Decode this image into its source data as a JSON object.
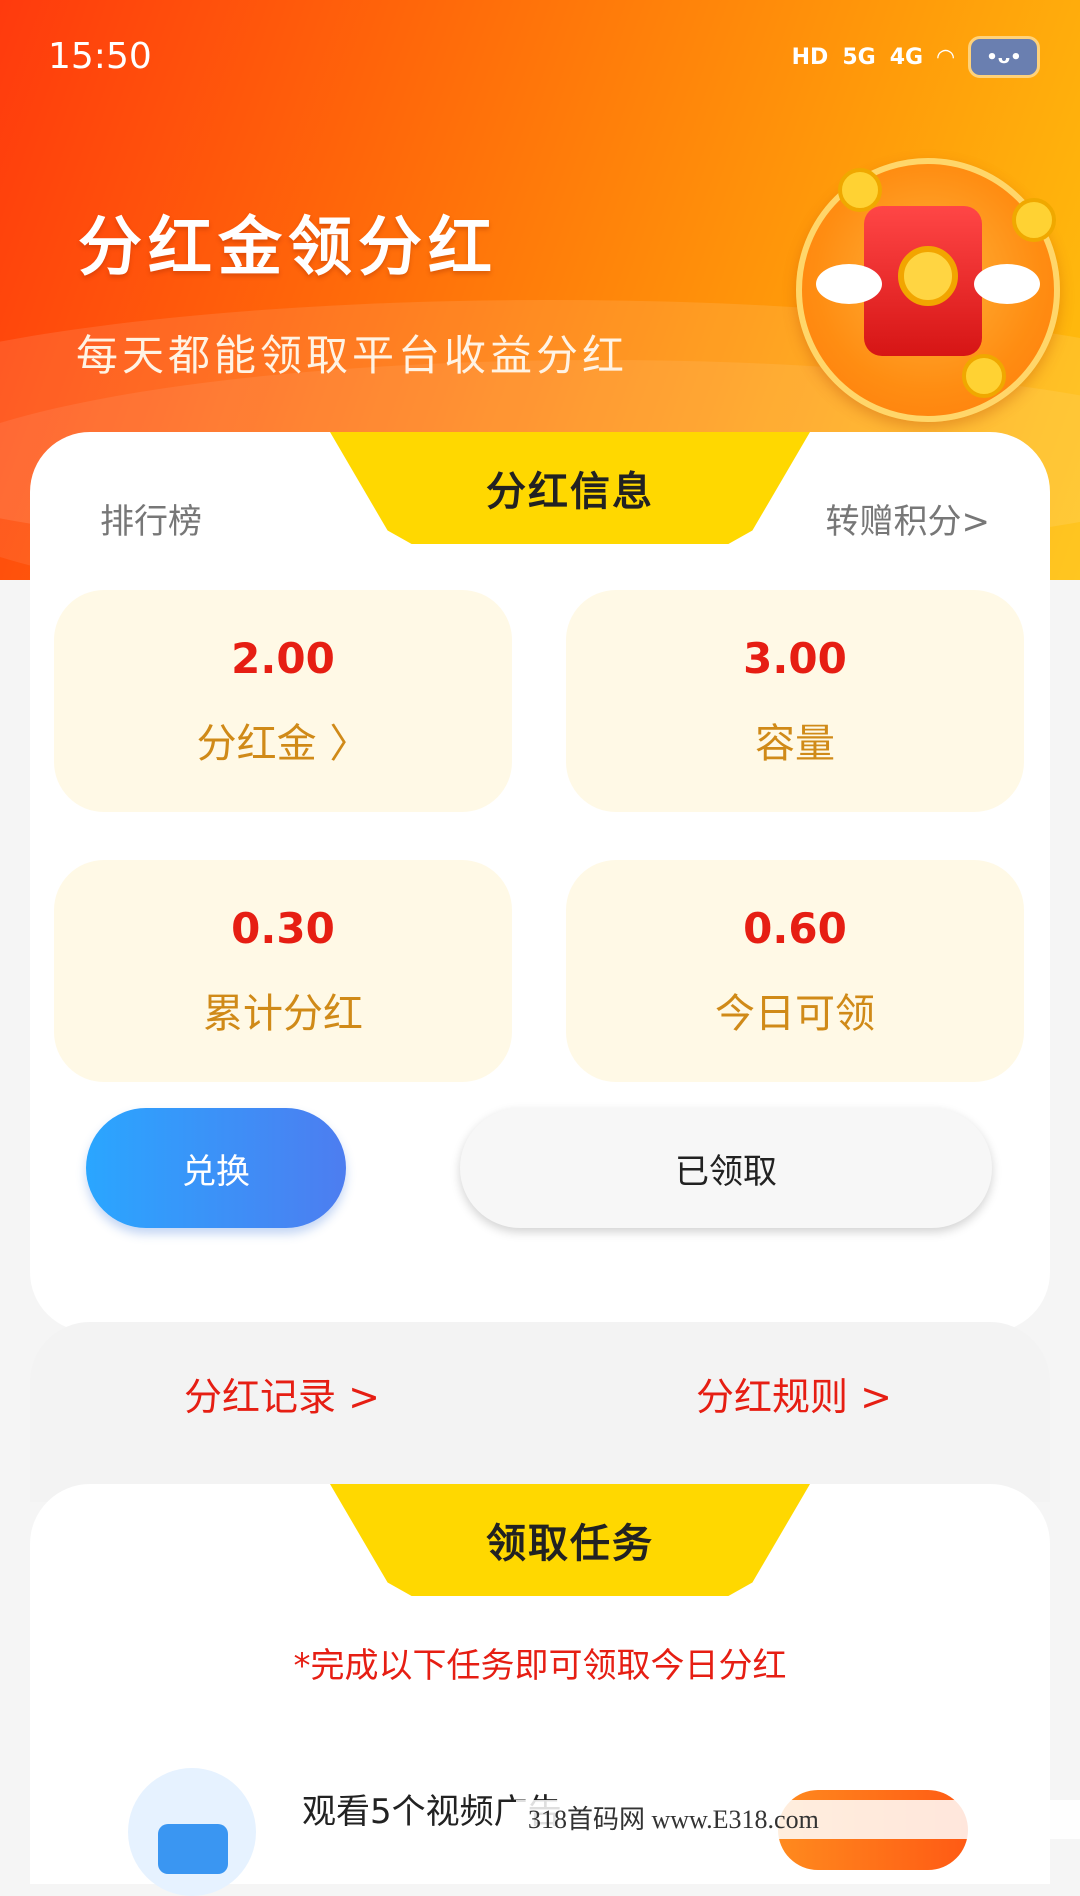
{
  "status_bar": {
    "time": "15:50",
    "network_hd": "HD",
    "network_5g": "5G",
    "network_4g": "4G"
  },
  "hero": {
    "title": "分红金领分红",
    "subtitle": "每天都能领取平台收益分红"
  },
  "tabs": {
    "left": "排行榜",
    "center": "分红信息",
    "right": "转赠积分>"
  },
  "stats": [
    {
      "value": "2.00",
      "label": "分红金 〉"
    },
    {
      "value": "3.00",
      "label": "容量"
    },
    {
      "value": "0.30",
      "label": "累计分红"
    },
    {
      "value": "0.60",
      "label": "今日可领"
    }
  ],
  "buttons": {
    "exchange": "兑换",
    "claimed": "已领取"
  },
  "links": {
    "records": "分红记录 >",
    "rules": "分红规则 >"
  },
  "tasks": {
    "header": "领取任务",
    "note": "*完成以下任务即可领取今日分红",
    "items": [
      {
        "title": "观看5个视频广告"
      }
    ]
  },
  "watermark": "318首码网 www.E318.com"
}
